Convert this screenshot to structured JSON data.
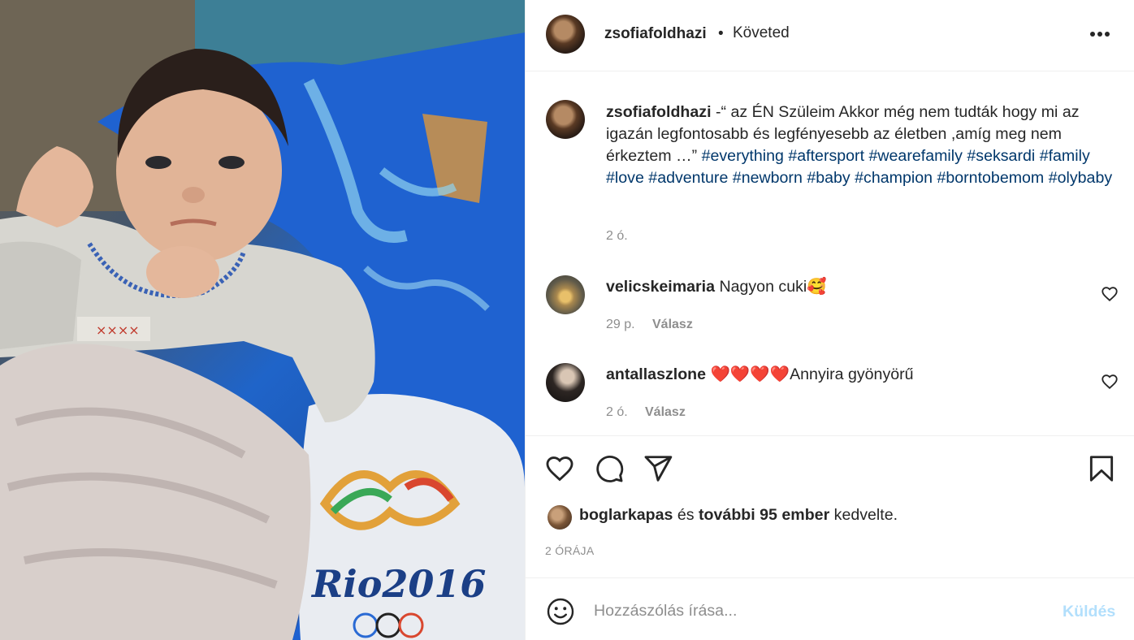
{
  "header": {
    "username": "zsofiafoldhazi",
    "separator": "•",
    "follow_status": "Követed"
  },
  "caption": {
    "username": "zsofiafoldhazi",
    "text": " -“ az ÉN Szüleim Akkor még nem tudták hogy mi az igazán legfontosabb és legfényesebb az életben ,amíg meg nem érkeztem …” ",
    "hashtags": [
      "#everything",
      "#aftersport",
      "#wearefamily",
      "#seksardi",
      "#family",
      "#love",
      "#adventure",
      "#newborn",
      "#baby",
      "#champion",
      "#borntobemom",
      "#olybaby"
    ],
    "time": "2 ó."
  },
  "comments": [
    {
      "username": "velicskeimaria",
      "text": " Nagyon cuki🥰",
      "time": "29 p.",
      "reply_label": "Válasz"
    },
    {
      "username": "antallaszlone",
      "text": " ❤️❤️❤️❤️Annyira gyönyörű",
      "time": "2 ó.",
      "reply_label": "Válasz"
    }
  ],
  "likes": {
    "liker": "boglarkapas",
    "connector": " és ",
    "others": "további 95 ember",
    "suffix": " kedvelte."
  },
  "posted": "2 ÓRÁJA",
  "add_comment": {
    "placeholder": "Hozzászólás írása...",
    "send_label": "Küldés"
  },
  "photo": {
    "banner_text": "Rio2016"
  },
  "icons": {
    "more": "more-options-icon",
    "like": "heart-icon",
    "comment": "comment-icon",
    "share": "paper-plane-icon",
    "save": "bookmark-icon",
    "emoji": "smiley-icon"
  },
  "colors": {
    "hashtag": "#00376b",
    "meta": "#8e8e8e",
    "send_disabled": "#b2dffc"
  }
}
